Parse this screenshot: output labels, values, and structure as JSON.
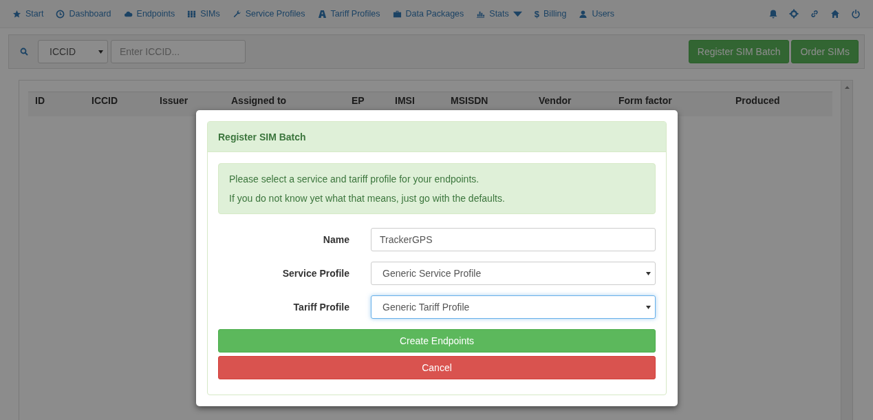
{
  "navbar": {
    "items": [
      {
        "label": "Start"
      },
      {
        "label": "Dashboard"
      },
      {
        "label": "Endpoints"
      },
      {
        "label": "SIMs"
      },
      {
        "label": "Service Profiles"
      },
      {
        "label": "Tariff Profiles"
      },
      {
        "label": "Data Packages"
      },
      {
        "label": "Stats",
        "dropdown": true
      },
      {
        "label": "Billing",
        "glyph": "$"
      },
      {
        "label": "Users"
      }
    ]
  },
  "search": {
    "field_select": "ICCID",
    "placeholder": "Enter ICCID..."
  },
  "actions": [
    "Register SIM Batch",
    "Order SIMs"
  ],
  "table": {
    "columns": [
      "ID",
      "ICCID",
      "Issuer",
      "Assigned to",
      "EP",
      "IMSI",
      "MSISDN",
      "Vendor",
      "Form factor",
      "Produced"
    ]
  },
  "modal": {
    "title": "Register SIM Batch",
    "alert": [
      "Please select a service and tariff profile for your endpoints.",
      "If you do not know yet what that means, just go with the defaults."
    ],
    "fields": [
      {
        "label": "Name",
        "kind": "text",
        "value": "TrackerGPS",
        "focused": false
      },
      {
        "label": "Service Profile",
        "kind": "select",
        "value": "Generic Service Profile",
        "focused": false
      },
      {
        "label": "Tariff Profile",
        "kind": "select",
        "value": "Generic Tariff Profile",
        "focused": true
      }
    ],
    "buttons": [
      {
        "label": "Create Endpoints",
        "kind": "success"
      },
      {
        "label": "Cancel",
        "kind": "danger"
      }
    ]
  }
}
